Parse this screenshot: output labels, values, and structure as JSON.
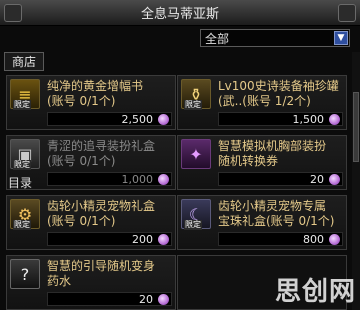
{
  "window": {
    "title": "全息马蒂亚斯"
  },
  "filter": {
    "selected": "全部"
  },
  "tabs": {
    "shop": "商店"
  },
  "catalog_label": "目录",
  "items": [
    {
      "name_line1": "纯净的黄金增幅书",
      "name_line2": "(账号 0/1个)",
      "badge": "限定",
      "price": "2,500",
      "icon": "book-icon"
    },
    {
      "name_line1": "Lv100史诗装备袖珍罐",
      "name_line2": "(武..(账号 1/2个)",
      "badge": "限定",
      "price": "1,500",
      "icon": "jar-icon"
    },
    {
      "name_line1": "青涩的追寻装扮礼盒",
      "name_line2": "(账号 0/1个)",
      "badge": "限定",
      "price": "1,000",
      "icon": "gift-box-icon"
    },
    {
      "name_line1": "智慧模拟机胸部装扮",
      "name_line2": "随机转换券",
      "badge": "",
      "price": "20",
      "icon": "ticket-icon"
    },
    {
      "name_line1": "齿轮小精灵宠物礼盒",
      "name_line2": "(账号 0/1个)",
      "badge": "限定",
      "price": "200",
      "icon": "gear-icon"
    },
    {
      "name_line1": "齿轮小精灵宠物专属",
      "name_line2": "宝珠礼盒(账号 0/1个)",
      "badge": "限定",
      "price": "800",
      "icon": "orb-gear-icon"
    },
    {
      "name_line1": "智慧的引导随机变身",
      "name_line2": "药水",
      "badge": "",
      "price": "20",
      "icon": "question-icon"
    }
  ],
  "watermark": "思创网"
}
